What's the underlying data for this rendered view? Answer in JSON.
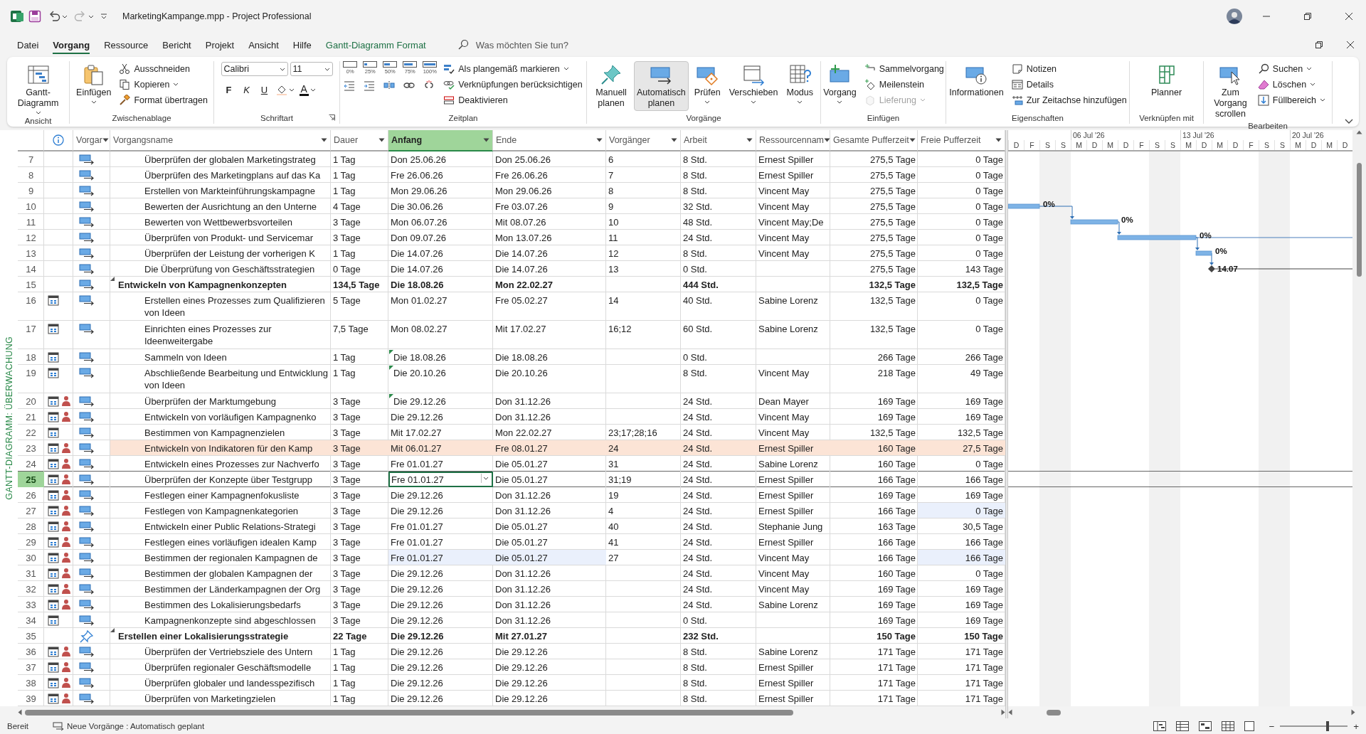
{
  "title_bar": {
    "title": "MarketingKampange.mpp  -  Project Professional"
  },
  "menu": {
    "tabs": [
      {
        "label": "Datei",
        "selected": false,
        "kind": "plain"
      },
      {
        "label": "Vorgang",
        "selected": true,
        "kind": "plain"
      },
      {
        "label": "Ressource",
        "selected": false,
        "kind": "plain"
      },
      {
        "label": "Bericht",
        "selected": false,
        "kind": "plain"
      },
      {
        "label": "Projekt",
        "selected": false,
        "kind": "plain"
      },
      {
        "label": "Ansicht",
        "selected": false,
        "kind": "plain"
      },
      {
        "label": "Hilfe",
        "selected": false,
        "kind": "plain"
      },
      {
        "label": "Gantt-Diagramm Format",
        "selected": false,
        "kind": "contextual"
      }
    ],
    "search": {
      "placeholder": "Was möchten Sie tun?"
    }
  },
  "ribbon": {
    "groups": [
      {
        "label": "Ansicht",
        "items": [
          {
            "kind": "large",
            "label": "Gantt-Diagramm",
            "dropdown": true,
            "selected": false
          }
        ]
      },
      {
        "label": "Zwischenablage",
        "items": [
          {
            "kind": "large",
            "label": "Einfügen",
            "dropdown": true,
            "selected": false
          },
          {
            "kind": "stack",
            "items": [
              {
                "label": "Ausschneiden",
                "dropdown": false,
                "disabled": false
              },
              {
                "label": "Kopieren",
                "dropdown": true,
                "disabled": false
              },
              {
                "label": "Format übertragen",
                "dropdown": false,
                "disabled": false
              }
            ]
          }
        ]
      },
      {
        "label": "Schriftart",
        "launcher": true,
        "items": [
          {
            "kind": "font",
            "family": "Calibri",
            "size": "11",
            "buttons": [
              "F",
              "K",
              "U"
            ],
            "font_color_letter": "A"
          }
        ]
      },
      {
        "label": "Zeitplan",
        "items": [
          {
            "kind": "schedule",
            "percents": [
              "0%",
              "25%",
              "50%",
              "75%",
              "100%"
            ]
          },
          {
            "kind": "stack",
            "items": [
              {
                "label": "Als plangemäß markieren",
                "dropdown": true,
                "disabled": false
              },
              {
                "label": "Verknüpfungen berücksichtigen",
                "dropdown": false,
                "disabled": false
              },
              {
                "label": "Deaktivieren",
                "dropdown": false,
                "disabled": false
              }
            ]
          }
        ]
      },
      {
        "label": "Vorgänge",
        "items": [
          {
            "kind": "large",
            "label": "Manuell planen",
            "dropdown": false,
            "selected": false
          },
          {
            "kind": "large",
            "label": "Automatisch planen",
            "dropdown": false,
            "selected": true
          },
          {
            "kind": "large",
            "label": "Prüfen",
            "dropdown": true,
            "selected": false
          },
          {
            "kind": "large",
            "label": "Verschieben",
            "dropdown": true,
            "selected": false
          },
          {
            "kind": "large",
            "label": "Modus",
            "dropdown": true,
            "selected": false
          }
        ]
      },
      {
        "label": "Einfügen",
        "items": [
          {
            "kind": "large",
            "label": "Vorgang",
            "dropdown": true,
            "selected": false
          },
          {
            "kind": "stack",
            "items": [
              {
                "label": "Sammelvorgang",
                "dropdown": false,
                "disabled": false
              },
              {
                "label": "Meilenstein",
                "dropdown": false,
                "disabled": false
              },
              {
                "label": "Lieferung",
                "dropdown": true,
                "disabled": true
              }
            ]
          }
        ]
      },
      {
        "label": "Eigenschaften",
        "items": [
          {
            "kind": "large",
            "label": "Informationen",
            "dropdown": false,
            "selected": false
          },
          {
            "kind": "stack",
            "items": [
              {
                "label": "Notizen",
                "dropdown": false,
                "disabled": false
              },
              {
                "label": "Details",
                "dropdown": false,
                "disabled": false
              },
              {
                "label": "Zur Zeitachse hinzufügen",
                "dropdown": false,
                "disabled": false
              }
            ]
          }
        ]
      },
      {
        "label": "Verknüpfen mit",
        "items": [
          {
            "kind": "large",
            "label": "Planner",
            "dropdown": false,
            "selected": false
          }
        ]
      },
      {
        "label": "Bearbeiten",
        "items": [
          {
            "kind": "large",
            "label": "Zum Vorgang scrollen",
            "dropdown": false,
            "selected": false
          },
          {
            "kind": "stack",
            "items": [
              {
                "label": "Suchen",
                "dropdown": true,
                "disabled": false
              },
              {
                "label": "Löschen",
                "dropdown": true,
                "disabled": false
              },
              {
                "label": "Füllbereich",
                "dropdown": true,
                "disabled": false
              }
            ]
          }
        ]
      }
    ]
  },
  "side_label": "GANTT-DIAGRAMM: ÜBERWACHUNG",
  "table": {
    "columns": [
      {
        "selected": false
      },
      {
        "label": "Vorgar",
        "selected": false
      },
      {
        "label": "Vorgangsname",
        "selected": false
      },
      {
        "label": "Dauer",
        "selected": false
      },
      {
        "label": "Anfang",
        "selected": true
      },
      {
        "label": "Ende",
        "selected": false
      },
      {
        "label": "Vorgänger",
        "selected": false
      },
      {
        "label": "Arbeit",
        "selected": false
      },
      {
        "label": "Ressourcennam",
        "selected": false
      },
      {
        "label": "Gesamte Pufferzeit",
        "selected": false
      },
      {
        "label": "Freie Pufferzeit",
        "selected": false
      }
    ],
    "rows": [
      {
        "id": "7",
        "cal": false,
        "res": false,
        "manual": false,
        "summary": false,
        "wrap": false,
        "flag": false,
        "hl": false,
        "selected": false,
        "ch_start": false,
        "ch_end": false,
        "ch_free": false,
        "name": "Überprüfen der globalen Marketingstrateg",
        "duration": "1 Tag",
        "start": "Don 25.06.26",
        "end": "Don 25.06.26",
        "pred": "6",
        "work": "8 Std.",
        "resource": "Ernest Spiller",
        "total_slack": "275,5 Tage",
        "free_slack": "0 Tage"
      },
      {
        "id": "8",
        "cal": false,
        "res": false,
        "manual": false,
        "summary": false,
        "wrap": false,
        "flag": false,
        "hl": false,
        "selected": false,
        "ch_start": false,
        "ch_end": false,
        "ch_free": false,
        "name": "Überprüfen des Marketingplans auf das Ka",
        "duration": "1 Tag",
        "start": "Fre 26.06.26",
        "end": "Fre 26.06.26",
        "pred": "7",
        "work": "8 Std.",
        "resource": "Ernest Spiller",
        "total_slack": "275,5 Tage",
        "free_slack": "0 Tage"
      },
      {
        "id": "9",
        "cal": false,
        "res": false,
        "manual": false,
        "summary": false,
        "wrap": false,
        "flag": false,
        "hl": false,
        "selected": false,
        "ch_start": false,
        "ch_end": false,
        "ch_free": false,
        "name": "Erstellen von Markteinführungskampagne",
        "duration": "1 Tag",
        "start": "Mon 29.06.26",
        "end": "Mon 29.06.26",
        "pred": "8",
        "work": "8 Std.",
        "resource": "Vincent May",
        "total_slack": "275,5 Tage",
        "free_slack": "0 Tage"
      },
      {
        "id": "10",
        "cal": false,
        "res": false,
        "manual": false,
        "summary": false,
        "wrap": false,
        "flag": false,
        "hl": false,
        "selected": false,
        "ch_start": false,
        "ch_end": false,
        "ch_free": false,
        "name": "Bewerten der Ausrichtung an den Unterne",
        "duration": "4 Tage",
        "start": "Die 30.06.26",
        "end": "Fre 03.07.26",
        "pred": "9",
        "work": "32 Std.",
        "resource": "Vincent May",
        "total_slack": "275,5 Tage",
        "free_slack": "0 Tage",
        "bar": {
          "kind": "task",
          "label": "0%"
        }
      },
      {
        "id": "11",
        "cal": false,
        "res": false,
        "manual": false,
        "summary": false,
        "wrap": false,
        "flag": false,
        "hl": false,
        "selected": false,
        "ch_start": false,
        "ch_end": false,
        "ch_free": false,
        "name": "Bewerten von Wettbewerbsvorteilen",
        "duration": "3 Tage",
        "start": "Mon 06.07.26",
        "end": "Mit 08.07.26",
        "pred": "10",
        "work": "48 Std.",
        "resource": "Vincent May;De",
        "total_slack": "275,5 Tage",
        "free_slack": "0 Tage",
        "bar": {
          "kind": "task",
          "label": "0%"
        }
      },
      {
        "id": "12",
        "cal": false,
        "res": false,
        "manual": false,
        "summary": false,
        "wrap": false,
        "flag": false,
        "hl": false,
        "selected": false,
        "ch_start": false,
        "ch_end": false,
        "ch_free": false,
        "name": "Überprüfen von Produkt- und Servicemar",
        "duration": "3 Tage",
        "start": "Don 09.07.26",
        "end": "Mon 13.07.26",
        "pred": "11",
        "work": "24 Std.",
        "resource": "Vincent May",
        "total_slack": "275,5 Tage",
        "free_slack": "0 Tage",
        "bar": {
          "kind": "task",
          "label": "0%"
        }
      },
      {
        "id": "13",
        "cal": false,
        "res": false,
        "manual": false,
        "summary": false,
        "wrap": false,
        "flag": false,
        "hl": false,
        "selected": false,
        "ch_start": false,
        "ch_end": false,
        "ch_free": false,
        "name": "Überprüfen der Leistung der vorherigen K",
        "duration": "1 Tag",
        "start": "Die 14.07.26",
        "end": "Die 14.07.26",
        "pred": "12",
        "work": "8 Std.",
        "resource": "Vincent May",
        "total_slack": "275,5 Tage",
        "free_slack": "0 Tage",
        "bar": {
          "kind": "task",
          "label": "0%"
        }
      },
      {
        "id": "14",
        "cal": false,
        "res": false,
        "manual": false,
        "summary": false,
        "wrap": false,
        "flag": false,
        "hl": false,
        "selected": false,
        "ch_start": false,
        "ch_end": false,
        "ch_free": false,
        "name": "Die Überprüfung von Geschäftsstrategien",
        "duration": "0 Tage",
        "start": "Die 14.07.26",
        "end": "Die 14.07.26",
        "pred": "13",
        "work": "0 Std.",
        "total_slack": "275,5 Tage",
        "free_slack": "143 Tage",
        "bar": {
          "kind": "milestone",
          "label": "14.07"
        }
      },
      {
        "id": "15",
        "cal": false,
        "res": false,
        "manual": false,
        "summary": true,
        "wrap": false,
        "flag": false,
        "hl": false,
        "selected": false,
        "ch_start": false,
        "ch_end": false,
        "ch_free": false,
        "name": "Entwickeln von Kampagnenkonzepten",
        "duration": "134,5 Tage",
        "start": "Die 18.08.26",
        "end": "Mon 22.02.27",
        "work": "444 Std.",
        "total_slack": "132,5 Tage",
        "free_slack": "132,5 Tage"
      },
      {
        "id": "16",
        "cal": true,
        "res": false,
        "manual": false,
        "summary": false,
        "wrap": true,
        "flag": false,
        "hl": false,
        "selected": false,
        "ch_start": false,
        "ch_end": false,
        "ch_free": false,
        "name": "Erstellen eines Prozesses zum Qualifizieren von Ideen",
        "duration": "5 Tage",
        "start": "Mon 01.02.27",
        "end": "Fre 05.02.27",
        "pred": "14",
        "work": "40 Std.",
        "resource": "Sabine Lorenz",
        "total_slack": "132,5 Tage",
        "free_slack": "0 Tage"
      },
      {
        "id": "17",
        "cal": true,
        "res": false,
        "manual": false,
        "summary": false,
        "wrap": true,
        "flag": false,
        "hl": false,
        "selected": false,
        "ch_start": false,
        "ch_end": false,
        "ch_free": false,
        "name": "Einrichten eines Prozesses zur Ideenweitergabe",
        "duration": "7,5 Tage",
        "start": "Mon 08.02.27",
        "end": "Mit 17.02.27",
        "pred": "16;12",
        "work": "60 Std.",
        "resource": "Sabine Lorenz",
        "total_slack": "132,5 Tage",
        "free_slack": "0 Tage"
      },
      {
        "id": "18",
        "cal": true,
        "res": false,
        "manual": false,
        "summary": false,
        "wrap": false,
        "flag": true,
        "hl": false,
        "selected": false,
        "ch_start": false,
        "ch_end": false,
        "ch_free": false,
        "name": "Sammeln von Ideen",
        "duration": "1 Tag",
        "start": "Die 18.08.26",
        "end": "Die 18.08.26",
        "work": "0 Std.",
        "total_slack": "266 Tage",
        "free_slack": "266 Tage"
      },
      {
        "id": "19",
        "cal": true,
        "res": false,
        "manual": false,
        "summary": false,
        "wrap": true,
        "flag": true,
        "hl": false,
        "selected": false,
        "ch_start": false,
        "ch_end": false,
        "ch_free": false,
        "name": "Abschließende Bearbeitung und Entwicklung von Ideen",
        "duration": "1 Tag",
        "start": "Die 20.10.26",
        "end": "Die 20.10.26",
        "work": "8 Std.",
        "resource": "Vincent May",
        "total_slack": "218 Tage",
        "free_slack": "49 Tage"
      },
      {
        "id": "20",
        "cal": true,
        "res": true,
        "manual": false,
        "summary": false,
        "wrap": false,
        "flag": true,
        "hl": false,
        "selected": false,
        "ch_start": false,
        "ch_end": false,
        "ch_free": false,
        "name": "Überprüfen der Marktumgebung",
        "duration": "3 Tage",
        "start": "Die 29.12.26",
        "end": "Don 31.12.26",
        "work": "24 Std.",
        "resource": "Dean Mayer",
        "total_slack": "169 Tage",
        "free_slack": "169 Tage"
      },
      {
        "id": "21",
        "cal": true,
        "res": true,
        "manual": false,
        "summary": false,
        "wrap": false,
        "flag": false,
        "hl": false,
        "selected": false,
        "ch_start": false,
        "ch_end": false,
        "ch_free": false,
        "name": "Entwickeln von vorläufigen Kampagnenko",
        "duration": "3 Tage",
        "start": "Die 29.12.26",
        "end": "Don 31.12.26",
        "work": "24 Std.",
        "resource": "Vincent May",
        "total_slack": "169 Tage",
        "free_slack": "169 Tage"
      },
      {
        "id": "22",
        "cal": true,
        "res": false,
        "manual": false,
        "summary": false,
        "wrap": false,
        "flag": false,
        "hl": false,
        "selected": false,
        "ch_start": false,
        "ch_end": false,
        "ch_free": false,
        "name": "Bestimmen von Kampagnenzielen",
        "duration": "3 Tage",
        "start": "Mit 17.02.27",
        "end": "Mon 22.02.27",
        "pred": "23;17;28;16",
        "work": "24 Std.",
        "resource": "Vincent May",
        "total_slack": "132,5 Tage",
        "free_slack": "132,5 Tage"
      },
      {
        "id": "23",
        "cal": true,
        "res": true,
        "manual": false,
        "summary": false,
        "wrap": false,
        "flag": false,
        "hl": true,
        "selected": false,
        "ch_start": false,
        "ch_end": false,
        "ch_free": false,
        "name": "Entwickeln von Indikatoren für den Kamp",
        "duration": "3 Tage",
        "start": "Mit 06.01.27",
        "end": "Fre 08.01.27",
        "pred": "24",
        "work": "24 Std.",
        "resource": "Ernest Spiller",
        "total_slack": "160 Tage",
        "free_slack": "27,5 Tage"
      },
      {
        "id": "24",
        "cal": true,
        "res": true,
        "manual": false,
        "summary": false,
        "wrap": false,
        "flag": false,
        "hl": false,
        "selected": false,
        "ch_start": false,
        "ch_end": false,
        "ch_free": false,
        "name": "Entwickeln eines Prozesses zur Nachverfo",
        "duration": "3 Tage",
        "start": "Fre 01.01.27",
        "end": "Die 05.01.27",
        "pred": "31",
        "work": "24 Std.",
        "resource": "Sabine Lorenz",
        "total_slack": "160 Tage",
        "free_slack": "0 Tage"
      },
      {
        "id": "25",
        "cal": true,
        "res": true,
        "manual": false,
        "summary": false,
        "wrap": false,
        "flag": false,
        "hl": false,
        "selected": true,
        "ch_start": false,
        "ch_end": false,
        "ch_free": false,
        "name": "Überprüfen der Konzepte über Testgrupp",
        "duration": "3 Tage",
        "start": "Fre 01.01.27",
        "end": "Die 05.01.27",
        "pred": "31;19",
        "work": "24 Std.",
        "resource": "Ernest Spiller",
        "total_slack": "166 Tage",
        "free_slack": "166 Tage"
      },
      {
        "id": "26",
        "cal": true,
        "res": true,
        "manual": false,
        "summary": false,
        "wrap": false,
        "flag": false,
        "hl": false,
        "selected": false,
        "ch_start": false,
        "ch_end": false,
        "ch_free": false,
        "name": "Festlegen einer Kampagnenfokusliste",
        "duration": "3 Tage",
        "start": "Die 29.12.26",
        "end": "Don 31.12.26",
        "pred": "19",
        "work": "24 Std.",
        "resource": "Ernest Spiller",
        "total_slack": "169 Tage",
        "free_slack": "169 Tage"
      },
      {
        "id": "27",
        "cal": true,
        "res": true,
        "manual": false,
        "summary": false,
        "wrap": false,
        "flag": false,
        "hl": false,
        "selected": false,
        "ch_start": false,
        "ch_end": false,
        "ch_free": true,
        "name": "Festlegen von Kampagnenkategorien",
        "duration": "3 Tage",
        "start": "Die 29.12.26",
        "end": "Don 31.12.26",
        "pred": "4",
        "work": "24 Std.",
        "resource": "Ernest Spiller",
        "total_slack": "166 Tage",
        "free_slack": "0 Tage"
      },
      {
        "id": "28",
        "cal": true,
        "res": true,
        "manual": false,
        "summary": false,
        "wrap": false,
        "flag": false,
        "hl": false,
        "selected": false,
        "ch_start": false,
        "ch_end": false,
        "ch_free": false,
        "name": "Entwickeln einer Public Relations-Strategi",
        "duration": "3 Tage",
        "start": "Fre 01.01.27",
        "end": "Die 05.01.27",
        "pred": "40",
        "work": "24 Std.",
        "resource": "Stephanie Jung",
        "total_slack": "163 Tage",
        "free_slack": "30,5 Tage"
      },
      {
        "id": "29",
        "cal": true,
        "res": true,
        "manual": false,
        "summary": false,
        "wrap": false,
        "flag": false,
        "hl": false,
        "selected": false,
        "ch_start": false,
        "ch_end": false,
        "ch_free": false,
        "name": "Festlegen eines vorläufigen idealen Kamp",
        "duration": "3 Tage",
        "start": "Fre 01.01.27",
        "end": "Die 05.01.27",
        "pred": "41",
        "work": "24 Std.",
        "resource": "Ernest Spiller",
        "total_slack": "166 Tage",
        "free_slack": "166 Tage"
      },
      {
        "id": "30",
        "cal": true,
        "res": true,
        "manual": false,
        "summary": false,
        "wrap": false,
        "flag": false,
        "hl": false,
        "selected": false,
        "ch_start": true,
        "ch_end": true,
        "ch_free": true,
        "name": "Bestimmen der regionalen Kampagnen de",
        "duration": "3 Tage",
        "start": "Fre 01.01.27",
        "end": "Die 05.01.27",
        "pred": "27",
        "work": "24 Std.",
        "resource": "Vincent May",
        "total_slack": "166 Tage",
        "free_slack": "166 Tage"
      },
      {
        "id": "31",
        "cal": true,
        "res": true,
        "manual": false,
        "summary": false,
        "wrap": false,
        "flag": false,
        "hl": false,
        "selected": false,
        "ch_start": false,
        "ch_end": false,
        "ch_free": false,
        "name": "Bestimmen der globalen Kampagnen der",
        "duration": "3 Tage",
        "start": "Die 29.12.26",
        "end": "Don 31.12.26",
        "work": "24 Std.",
        "resource": "Vincent May",
        "total_slack": "160 Tage",
        "free_slack": "0 Tage"
      },
      {
        "id": "32",
        "cal": true,
        "res": true,
        "manual": false,
        "summary": false,
        "wrap": false,
        "flag": false,
        "hl": false,
        "selected": false,
        "ch_start": false,
        "ch_end": false,
        "ch_free": false,
        "name": "Bestimmen der Länderkampagnen der Org",
        "duration": "3 Tage",
        "start": "Die 29.12.26",
        "end": "Don 31.12.26",
        "work": "24 Std.",
        "resource": "Vincent May",
        "total_slack": "169 Tage",
        "free_slack": "169 Tage"
      },
      {
        "id": "33",
        "cal": true,
        "res": true,
        "manual": false,
        "summary": false,
        "wrap": false,
        "flag": false,
        "hl": false,
        "selected": false,
        "ch_start": false,
        "ch_end": false,
        "ch_free": false,
        "name": "Bestimmen des Lokalisierungsbedarfs",
        "duration": "3 Tage",
        "start": "Die 29.12.26",
        "end": "Don 31.12.26",
        "work": "24 Std.",
        "resource": "Sabine Lorenz",
        "total_slack": "169 Tage",
        "free_slack": "169 Tage"
      },
      {
        "id": "34",
        "cal": true,
        "res": false,
        "manual": false,
        "summary": false,
        "wrap": false,
        "flag": false,
        "hl": false,
        "selected": false,
        "ch_start": false,
        "ch_end": false,
        "ch_free": false,
        "name": "Kampagnenkonzepte sind abgeschlossen",
        "duration": "3 Tage",
        "start": "Die 29.12.26",
        "end": "Don 31.12.26",
        "work": "0 Std.",
        "total_slack": "169 Tage",
        "free_slack": "169 Tage"
      },
      {
        "id": "35",
        "cal": false,
        "res": false,
        "manual": true,
        "summary": true,
        "wrap": false,
        "flag": false,
        "hl": false,
        "selected": false,
        "ch_start": false,
        "ch_end": false,
        "ch_free": false,
        "name": "Erstellen einer Lokalisierungsstrategie",
        "duration": "22 Tage",
        "start": "Die 29.12.26",
        "end": "Mit 27.01.27",
        "work": "232 Std.",
        "total_slack": "150 Tage",
        "free_slack": "150 Tage"
      },
      {
        "id": "36",
        "cal": true,
        "res": true,
        "manual": false,
        "summary": false,
        "wrap": false,
        "flag": false,
        "hl": false,
        "selected": false,
        "ch_start": false,
        "ch_end": false,
        "ch_free": false,
        "name": "Überprüfen der Vertriebsziele des Untern",
        "duration": "1 Tag",
        "start": "Die 29.12.26",
        "end": "Die 29.12.26",
        "work": "8 Std.",
        "resource": "Sabine Lorenz",
        "total_slack": "171 Tage",
        "free_slack": "171 Tage"
      },
      {
        "id": "37",
        "cal": true,
        "res": true,
        "manual": false,
        "summary": false,
        "wrap": false,
        "flag": false,
        "hl": false,
        "selected": false,
        "ch_start": false,
        "ch_end": false,
        "ch_free": false,
        "name": "Überprüfen regionaler Geschäftsmodelle",
        "duration": "1 Tag",
        "start": "Die 29.12.26",
        "end": "Die 29.12.26",
        "work": "8 Std.",
        "resource": "Ernest Spiller",
        "total_slack": "171 Tage",
        "free_slack": "171 Tage"
      },
      {
        "id": "38",
        "cal": true,
        "res": true,
        "manual": false,
        "summary": false,
        "wrap": false,
        "flag": false,
        "hl": false,
        "selected": false,
        "ch_start": false,
        "ch_end": false,
        "ch_free": false,
        "name": "Überprüfen globaler und landesspezifisch",
        "duration": "1 Tag",
        "start": "Die 29.12.26",
        "end": "Die 29.12.26",
        "work": "8 Std.",
        "resource": "Ernest Spiller",
        "total_slack": "171 Tage",
        "free_slack": "171 Tage"
      },
      {
        "id": "39",
        "cal": true,
        "res": true,
        "manual": false,
        "summary": false,
        "wrap": false,
        "flag": false,
        "hl": false,
        "selected": false,
        "ch_start": false,
        "ch_end": false,
        "ch_free": false,
        "name": "Überprüfen von Marketingzielen",
        "duration": "1 Tag",
        "start": "Die 29.12.26",
        "end": "Die 29.12.26",
        "work": "8 Std.",
        "resource": "Ernest Spiller",
        "total_slack": "171 Tage",
        "free_slack": "171 Tage"
      }
    ]
  },
  "gantt": {
    "weeks": [
      "06 Jul '26",
      "13 Jul '26",
      "20 Jul '26"
    ],
    "days": [
      "D",
      "F",
      "S",
      "S",
      "M",
      "D",
      "M",
      "D",
      "F",
      "S",
      "S",
      "M",
      "D",
      "M",
      "D",
      "F",
      "S",
      "S",
      "M",
      "D",
      "M",
      "D"
    ]
  },
  "status_bar": {
    "ready": "Bereit",
    "new_tasks": "Neue Vorgänge : Automatisch geplant",
    "zoom": {
      "minus": "−",
      "plus": "+",
      "level": 0.7
    }
  }
}
